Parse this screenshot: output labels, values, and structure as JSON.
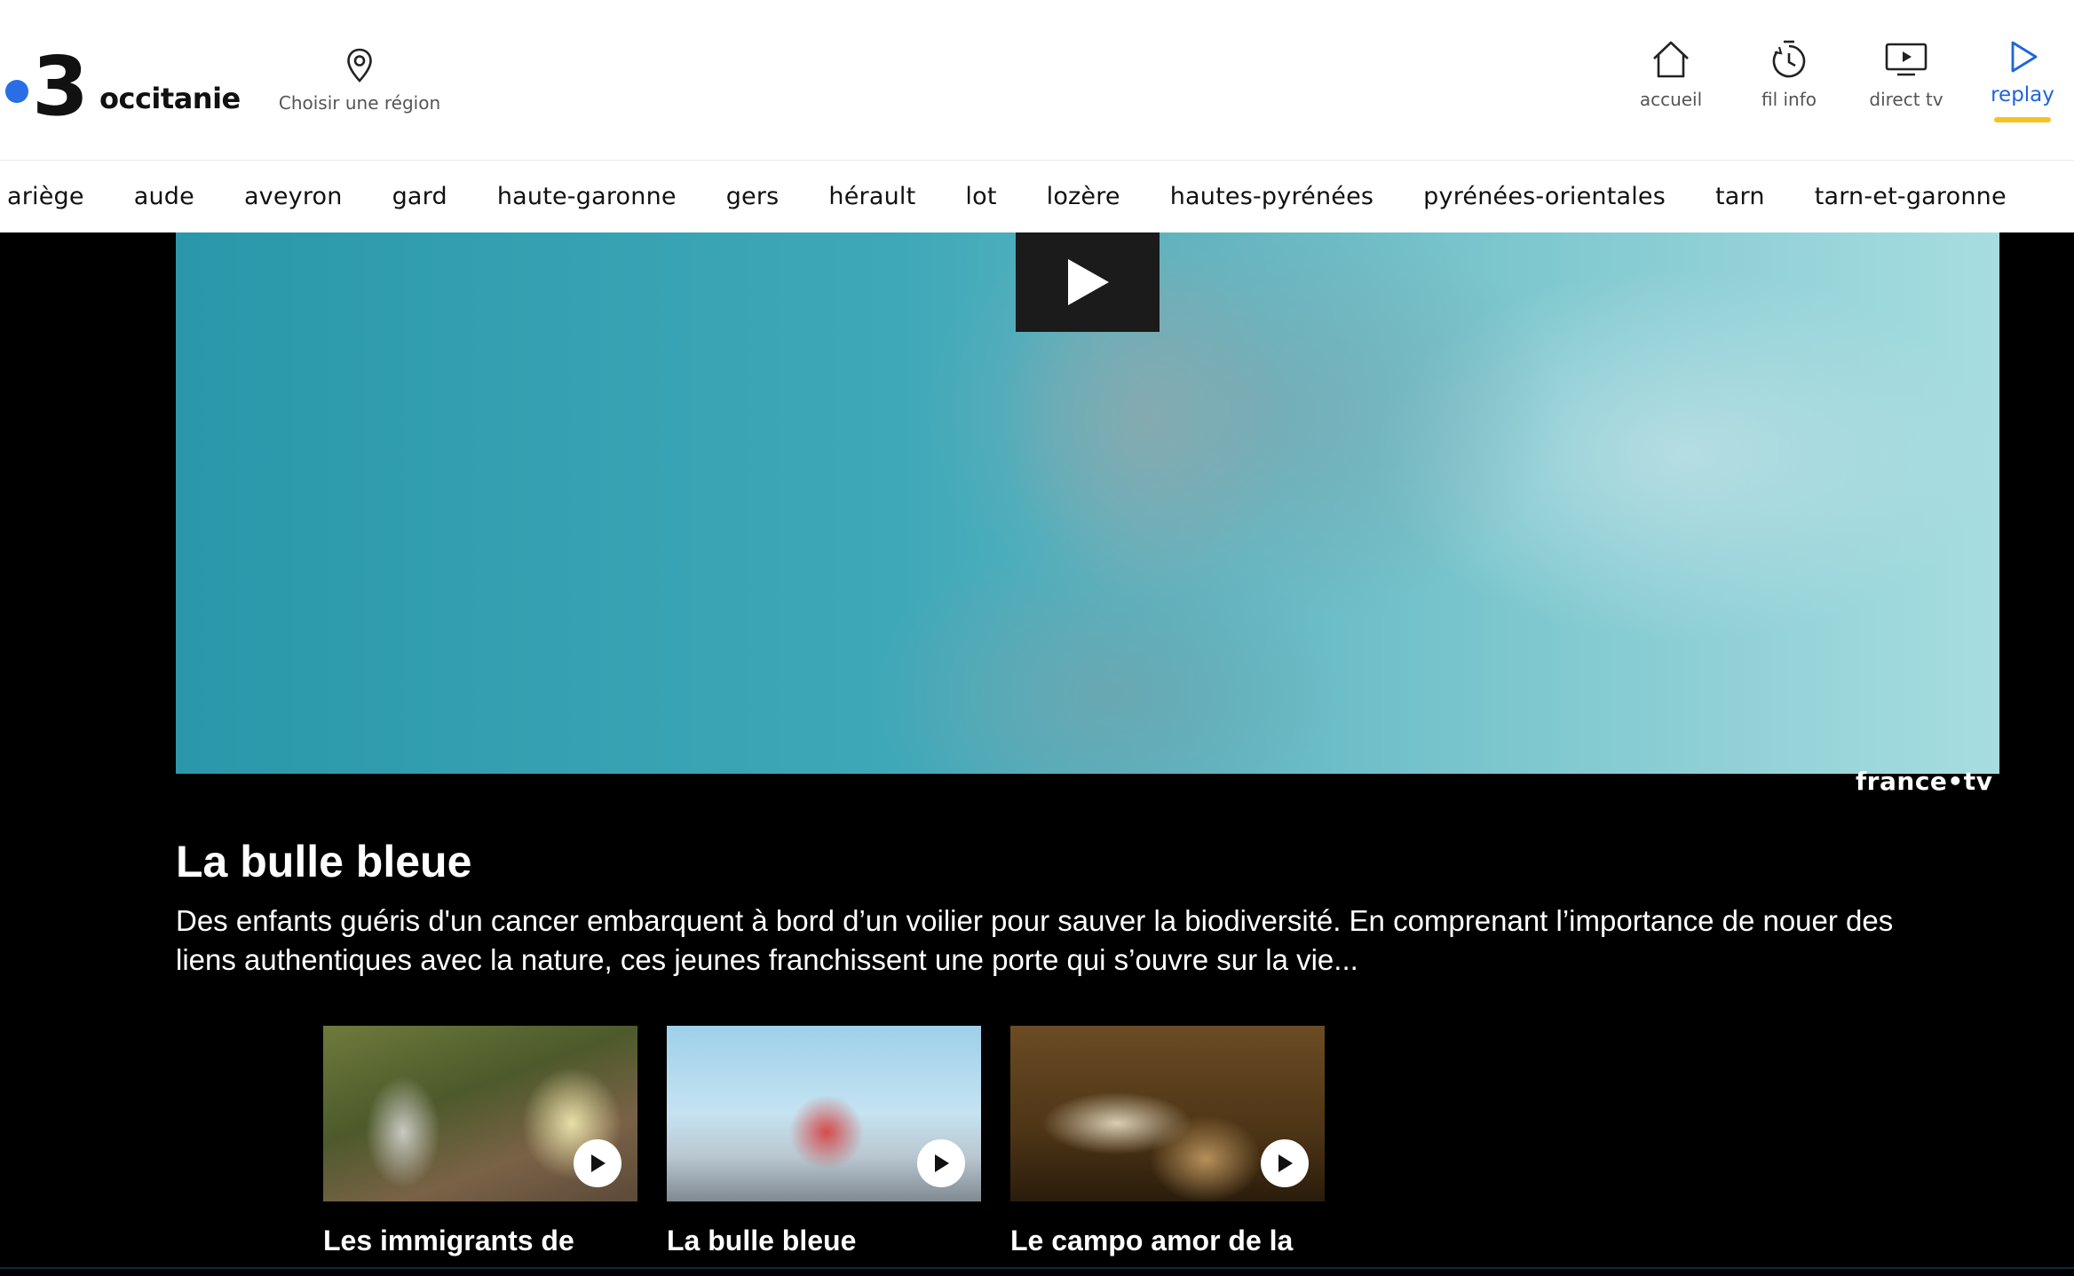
{
  "header": {
    "logo": {
      "number": "3",
      "name": "occitanie",
      "dot_color": "#2a6ee6"
    },
    "region": {
      "label": "Choisir une région",
      "icon": "location-pin-icon"
    },
    "nav": [
      {
        "label": "accueil",
        "icon": "home-icon",
        "active": false
      },
      {
        "label": "fil info",
        "icon": "stopwatch-icon",
        "active": false
      },
      {
        "label": "direct tv",
        "icon": "tv-icon",
        "active": false
      },
      {
        "label": "replay",
        "icon": "play-outline-icon",
        "active": true
      }
    ],
    "accent_color": "#1e64dc",
    "active_bar_color": "#f6c223"
  },
  "departments": [
    "ariège",
    "aude",
    "aveyron",
    "gard",
    "haute-garonne",
    "gers",
    "hérault",
    "lot",
    "lozère",
    "hautes-pyrénées",
    "pyrénées-orientales",
    "tarn",
    "tarn-et-garonne"
  ],
  "video": {
    "brand": "france•tv",
    "play_icon": "play-icon"
  },
  "program": {
    "title": "La bulle bleue",
    "description": "Des enfants guéris d'un cancer embarquent à bord d’un voilier pour sauver la biodiversité. En comprenant l’importance de nouer des liens authentiques avec la nature, ces jeunes franchissent une porte qui s’ouvre sur la vie..."
  },
  "related": [
    {
      "title": "Les immigrants de",
      "icon": "play-circle-icon"
    },
    {
      "title": "La bulle bleue",
      "icon": "play-circle-icon"
    },
    {
      "title": "Le campo amor de la",
      "icon": "play-circle-icon"
    }
  ]
}
